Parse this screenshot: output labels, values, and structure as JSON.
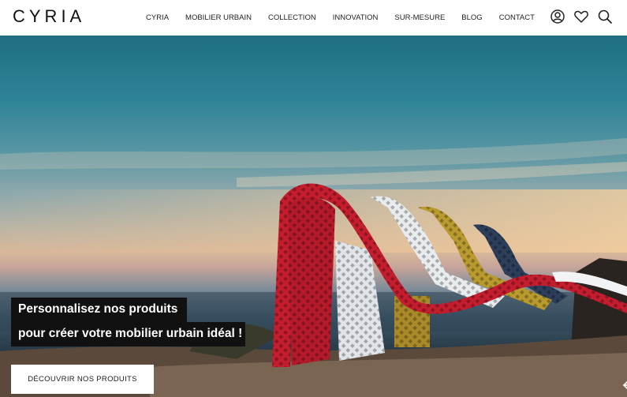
{
  "header": {
    "logo": "CYRIA",
    "nav": [
      "CYRIA",
      "MOBILIER URBAIN",
      "COLLECTION",
      "INNOVATION",
      "SUR-MESURE",
      "BLOG",
      "CONTACT"
    ],
    "icons": [
      "user-icon",
      "heart-icon",
      "search-icon"
    ]
  },
  "hero": {
    "line1": "Personnalisez nos produits",
    "line2": "pour créer votre mobilier urbain idéal !",
    "cta": "DÉCOUVRIR NOS PRODUITS",
    "prev_icon": "arrow-left-icon",
    "next_icon": "arrow-right-icon"
  },
  "colors": {
    "accent": "#111111",
    "bench_red": "#c41d2e",
    "bench_white": "#e9ecef",
    "bench_yellow": "#b99a2e",
    "bench_navy": "#2c3e5a"
  }
}
